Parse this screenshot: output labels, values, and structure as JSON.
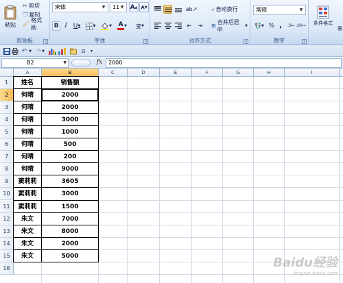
{
  "ribbon": {
    "clipboard": {
      "label": "剪贴板",
      "paste": "粘贴",
      "cut": "剪切",
      "copy": "复制",
      "format_painter": "格式刷"
    },
    "font": {
      "label": "字体",
      "font_name": "宋体",
      "font_size": "11",
      "grow": "A",
      "shrink": "A",
      "bold": "B",
      "italic": "I",
      "underline": "U",
      "font_color": "A",
      "phonetic": "变"
    },
    "alignment": {
      "label": "对齐方式",
      "wrap_text": "自动换行",
      "merge_center": "合并后居中"
    },
    "number": {
      "label": "数字",
      "format": "常规",
      "percent": "%",
      "comma": ","
    },
    "styles": {
      "conditional_format": "条件格式",
      "table_format_partial": "表"
    }
  },
  "formula_bar": {
    "name_box": "B2",
    "fx": "fx",
    "value": "2000"
  },
  "columns": [
    "A",
    "B",
    "C",
    "D",
    "E",
    "F",
    "G",
    "H",
    "I"
  ],
  "rows": [
    "1",
    "2",
    "3",
    "4",
    "5",
    "6",
    "7",
    "8",
    "9",
    "10",
    "11",
    "12",
    "13",
    "14",
    "15",
    "16"
  ],
  "table": {
    "header": [
      "姓名",
      "销售额"
    ],
    "data": [
      [
        "何晴",
        "2000"
      ],
      [
        "何晴",
        "2000"
      ],
      [
        "何晴",
        "3000"
      ],
      [
        "何晴",
        "1000"
      ],
      [
        "何晴",
        "500"
      ],
      [
        "何晴",
        "200"
      ],
      [
        "何晴",
        "9000"
      ],
      [
        "窦莉莉",
        "3605"
      ],
      [
        "窦莉莉",
        "3000"
      ],
      [
        "窦莉莉",
        "1500"
      ],
      [
        "朱文",
        "7000"
      ],
      [
        "朱文",
        "8000"
      ],
      [
        "朱文",
        "2000"
      ],
      [
        "朱文",
        "5000"
      ]
    ]
  },
  "selection": {
    "cell": "B2",
    "column": "B",
    "row": "2"
  },
  "watermark": {
    "text": "Baidu经验",
    "sub": "jingyan.baidu.com"
  }
}
